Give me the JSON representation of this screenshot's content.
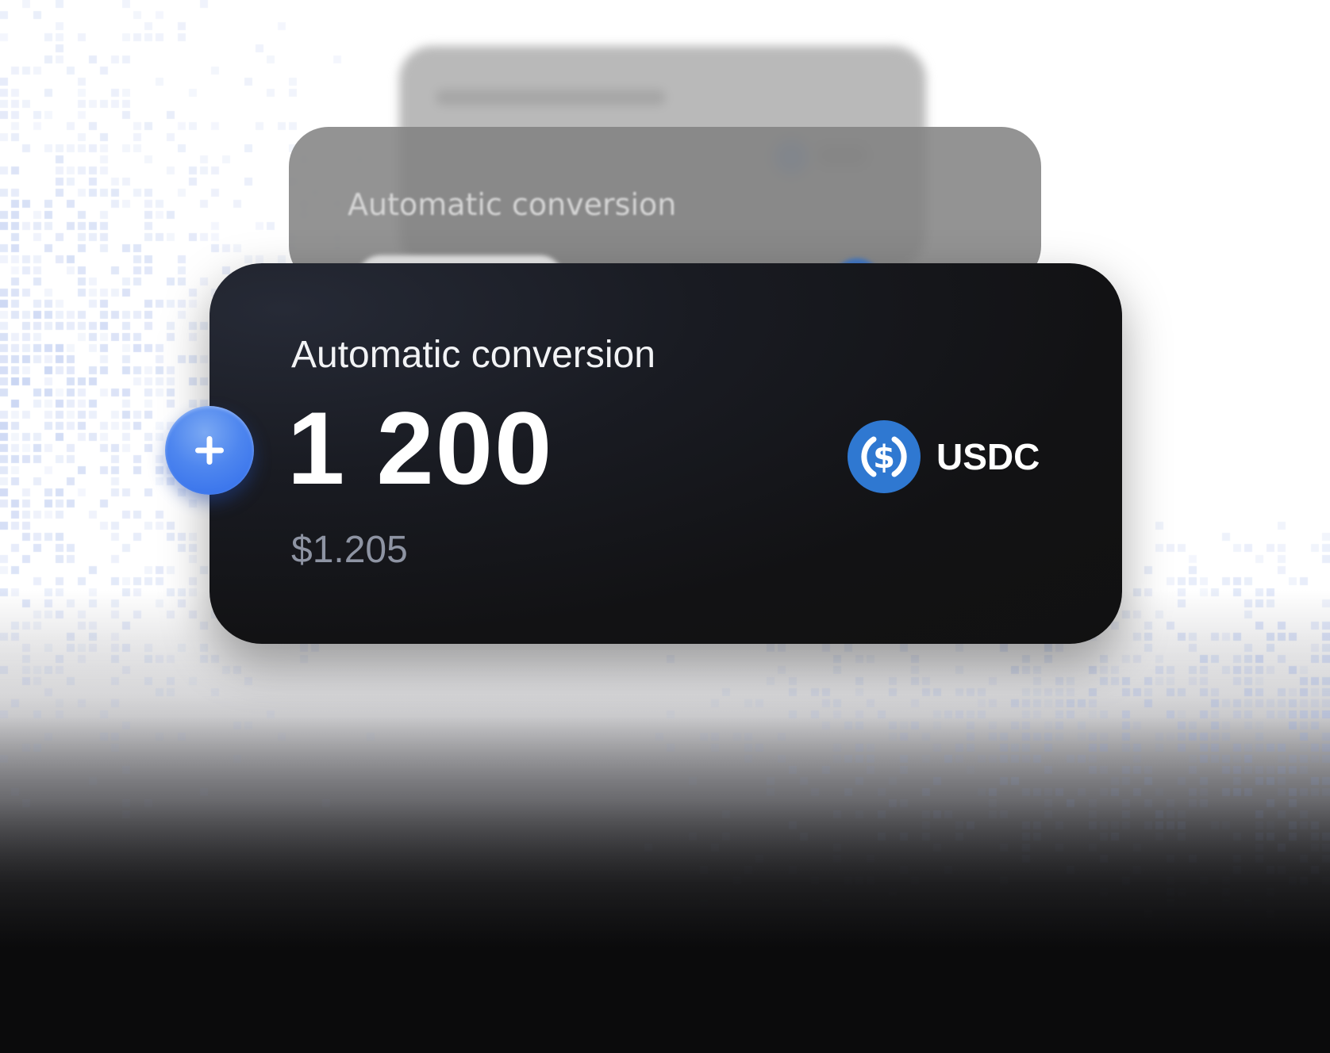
{
  "card": {
    "title": "Automatic conversion",
    "amount": "1 200",
    "fiat_value": "$1.205",
    "token": {
      "symbol": "USDC",
      "icon": "usdc-dollar-icon",
      "color": "#2f78d1"
    }
  },
  "ghost_card": {
    "title": "Automatic conversion"
  },
  "actions": {
    "add_icon": "plus-icon"
  },
  "colors": {
    "card_background": "#111111",
    "accent_blue": "#3b78ee",
    "muted_text": "#8e94a3",
    "pixel_tint": "#8fa8e6"
  }
}
